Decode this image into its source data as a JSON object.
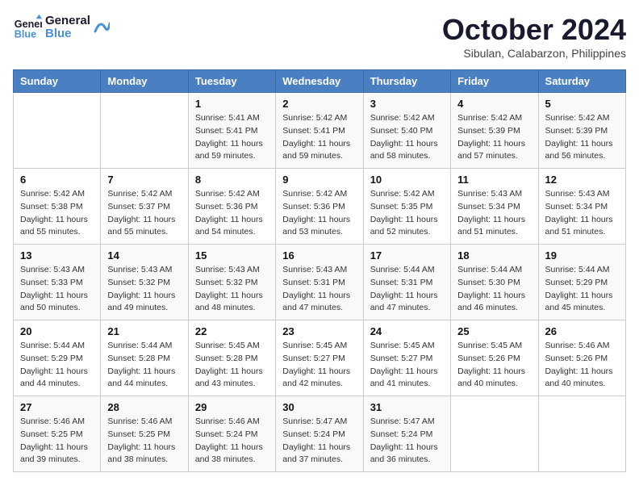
{
  "header": {
    "logo_general": "General",
    "logo_blue": "Blue",
    "month": "October 2024",
    "location": "Sibulan, Calabarzon, Philippines"
  },
  "weekdays": [
    "Sunday",
    "Monday",
    "Tuesday",
    "Wednesday",
    "Thursday",
    "Friday",
    "Saturday"
  ],
  "weeks": [
    [
      {
        "day": "",
        "sunrise": "",
        "sunset": "",
        "daylight": ""
      },
      {
        "day": "",
        "sunrise": "",
        "sunset": "",
        "daylight": ""
      },
      {
        "day": "1",
        "sunrise": "Sunrise: 5:41 AM",
        "sunset": "Sunset: 5:41 PM",
        "daylight": "Daylight: 11 hours and 59 minutes."
      },
      {
        "day": "2",
        "sunrise": "Sunrise: 5:42 AM",
        "sunset": "Sunset: 5:41 PM",
        "daylight": "Daylight: 11 hours and 59 minutes."
      },
      {
        "day": "3",
        "sunrise": "Sunrise: 5:42 AM",
        "sunset": "Sunset: 5:40 PM",
        "daylight": "Daylight: 11 hours and 58 minutes."
      },
      {
        "day": "4",
        "sunrise": "Sunrise: 5:42 AM",
        "sunset": "Sunset: 5:39 PM",
        "daylight": "Daylight: 11 hours and 57 minutes."
      },
      {
        "day": "5",
        "sunrise": "Sunrise: 5:42 AM",
        "sunset": "Sunset: 5:39 PM",
        "daylight": "Daylight: 11 hours and 56 minutes."
      }
    ],
    [
      {
        "day": "6",
        "sunrise": "Sunrise: 5:42 AM",
        "sunset": "Sunset: 5:38 PM",
        "daylight": "Daylight: 11 hours and 55 minutes."
      },
      {
        "day": "7",
        "sunrise": "Sunrise: 5:42 AM",
        "sunset": "Sunset: 5:37 PM",
        "daylight": "Daylight: 11 hours and 55 minutes."
      },
      {
        "day": "8",
        "sunrise": "Sunrise: 5:42 AM",
        "sunset": "Sunset: 5:36 PM",
        "daylight": "Daylight: 11 hours and 54 minutes."
      },
      {
        "day": "9",
        "sunrise": "Sunrise: 5:42 AM",
        "sunset": "Sunset: 5:36 PM",
        "daylight": "Daylight: 11 hours and 53 minutes."
      },
      {
        "day": "10",
        "sunrise": "Sunrise: 5:42 AM",
        "sunset": "Sunset: 5:35 PM",
        "daylight": "Daylight: 11 hours and 52 minutes."
      },
      {
        "day": "11",
        "sunrise": "Sunrise: 5:43 AM",
        "sunset": "Sunset: 5:34 PM",
        "daylight": "Daylight: 11 hours and 51 minutes."
      },
      {
        "day": "12",
        "sunrise": "Sunrise: 5:43 AM",
        "sunset": "Sunset: 5:34 PM",
        "daylight": "Daylight: 11 hours and 51 minutes."
      }
    ],
    [
      {
        "day": "13",
        "sunrise": "Sunrise: 5:43 AM",
        "sunset": "Sunset: 5:33 PM",
        "daylight": "Daylight: 11 hours and 50 minutes."
      },
      {
        "day": "14",
        "sunrise": "Sunrise: 5:43 AM",
        "sunset": "Sunset: 5:32 PM",
        "daylight": "Daylight: 11 hours and 49 minutes."
      },
      {
        "day": "15",
        "sunrise": "Sunrise: 5:43 AM",
        "sunset": "Sunset: 5:32 PM",
        "daylight": "Daylight: 11 hours and 48 minutes."
      },
      {
        "day": "16",
        "sunrise": "Sunrise: 5:43 AM",
        "sunset": "Sunset: 5:31 PM",
        "daylight": "Daylight: 11 hours and 47 minutes."
      },
      {
        "day": "17",
        "sunrise": "Sunrise: 5:44 AM",
        "sunset": "Sunset: 5:31 PM",
        "daylight": "Daylight: 11 hours and 47 minutes."
      },
      {
        "day": "18",
        "sunrise": "Sunrise: 5:44 AM",
        "sunset": "Sunset: 5:30 PM",
        "daylight": "Daylight: 11 hours and 46 minutes."
      },
      {
        "day": "19",
        "sunrise": "Sunrise: 5:44 AM",
        "sunset": "Sunset: 5:29 PM",
        "daylight": "Daylight: 11 hours and 45 minutes."
      }
    ],
    [
      {
        "day": "20",
        "sunrise": "Sunrise: 5:44 AM",
        "sunset": "Sunset: 5:29 PM",
        "daylight": "Daylight: 11 hours and 44 minutes."
      },
      {
        "day": "21",
        "sunrise": "Sunrise: 5:44 AM",
        "sunset": "Sunset: 5:28 PM",
        "daylight": "Daylight: 11 hours and 44 minutes."
      },
      {
        "day": "22",
        "sunrise": "Sunrise: 5:45 AM",
        "sunset": "Sunset: 5:28 PM",
        "daylight": "Daylight: 11 hours and 43 minutes."
      },
      {
        "day": "23",
        "sunrise": "Sunrise: 5:45 AM",
        "sunset": "Sunset: 5:27 PM",
        "daylight": "Daylight: 11 hours and 42 minutes."
      },
      {
        "day": "24",
        "sunrise": "Sunrise: 5:45 AM",
        "sunset": "Sunset: 5:27 PM",
        "daylight": "Daylight: 11 hours and 41 minutes."
      },
      {
        "day": "25",
        "sunrise": "Sunrise: 5:45 AM",
        "sunset": "Sunset: 5:26 PM",
        "daylight": "Daylight: 11 hours and 40 minutes."
      },
      {
        "day": "26",
        "sunrise": "Sunrise: 5:46 AM",
        "sunset": "Sunset: 5:26 PM",
        "daylight": "Daylight: 11 hours and 40 minutes."
      }
    ],
    [
      {
        "day": "27",
        "sunrise": "Sunrise: 5:46 AM",
        "sunset": "Sunset: 5:25 PM",
        "daylight": "Daylight: 11 hours and 39 minutes."
      },
      {
        "day": "28",
        "sunrise": "Sunrise: 5:46 AM",
        "sunset": "Sunset: 5:25 PM",
        "daylight": "Daylight: 11 hours and 38 minutes."
      },
      {
        "day": "29",
        "sunrise": "Sunrise: 5:46 AM",
        "sunset": "Sunset: 5:24 PM",
        "daylight": "Daylight: 11 hours and 38 minutes."
      },
      {
        "day": "30",
        "sunrise": "Sunrise: 5:47 AM",
        "sunset": "Sunset: 5:24 PM",
        "daylight": "Daylight: 11 hours and 37 minutes."
      },
      {
        "day": "31",
        "sunrise": "Sunrise: 5:47 AM",
        "sunset": "Sunset: 5:24 PM",
        "daylight": "Daylight: 11 hours and 36 minutes."
      },
      {
        "day": "",
        "sunrise": "",
        "sunset": "",
        "daylight": ""
      },
      {
        "day": "",
        "sunrise": "",
        "sunset": "",
        "daylight": ""
      }
    ]
  ]
}
